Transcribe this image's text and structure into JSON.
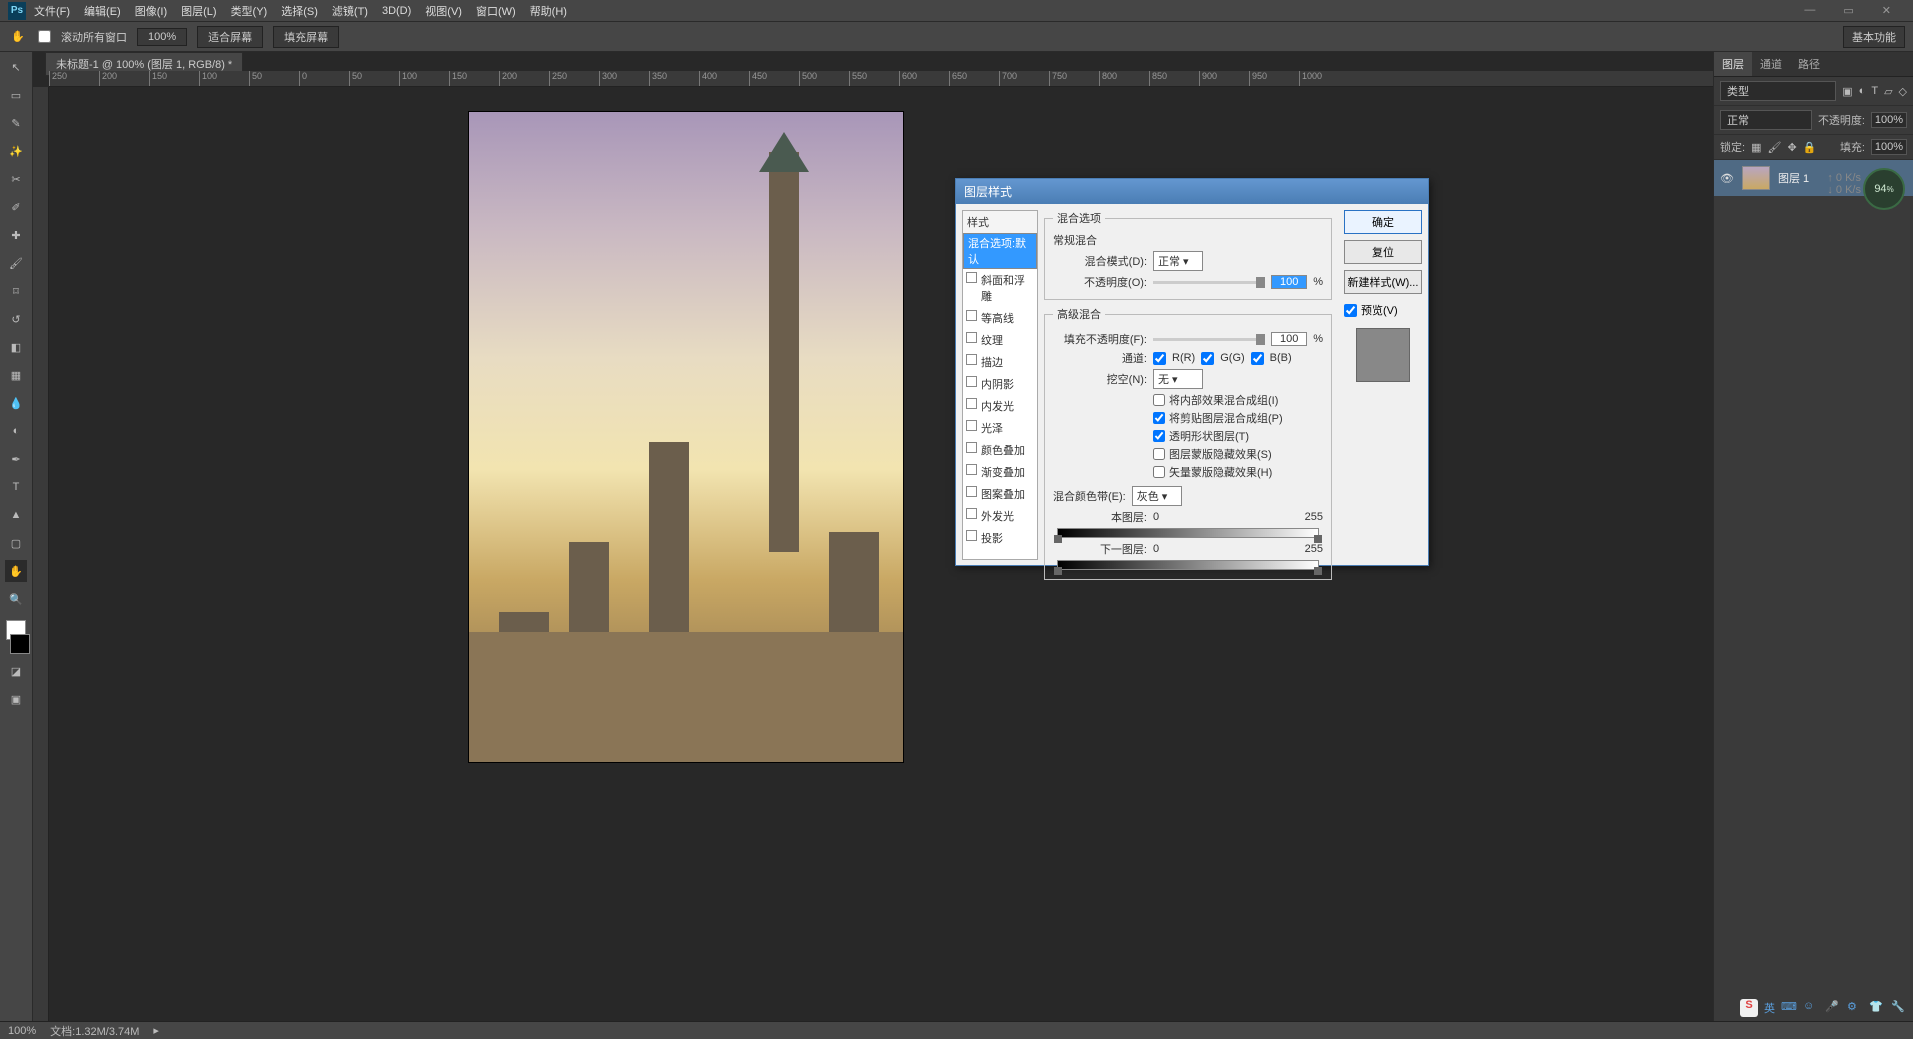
{
  "menu": {
    "items": [
      "文件(F)",
      "编辑(E)",
      "图像(I)",
      "图层(L)",
      "类型(Y)",
      "选择(S)",
      "滤镜(T)",
      "3D(D)",
      "视图(V)",
      "窗口(W)",
      "帮助(H)"
    ]
  },
  "options": {
    "scroll_all": "滚动所有窗口",
    "zoom": "100%",
    "fit": "适合屏幕",
    "fill": "填充屏幕",
    "workspace": "基本功能"
  },
  "document": {
    "tab": "未标题-1 @ 100% (图层 1, RGB/8) *"
  },
  "ruler_marks": [
    "250",
    "200",
    "150",
    "100",
    "50",
    "0",
    "50",
    "100",
    "150",
    "200",
    "250",
    "300",
    "350",
    "400",
    "450",
    "500",
    "550",
    "600",
    "650",
    "700",
    "750",
    "800",
    "850",
    "900",
    "950",
    "1000"
  ],
  "panels": {
    "tabs": [
      "图层",
      "通道",
      "路径"
    ],
    "kind": "类型",
    "mode": "正常",
    "opacity_lbl": "不透明度:",
    "opacity": "100%",
    "lock_lbl": "锁定:",
    "fill_lbl": "填充:",
    "fill": "100%",
    "layer_name": "图层 1"
  },
  "dialog": {
    "title": "图层样式",
    "styles_hdr": "样式",
    "styles": [
      "混合选项:默认",
      "斜面和浮雕",
      "等高线",
      "纹理",
      "描边",
      "内阴影",
      "内发光",
      "光泽",
      "颜色叠加",
      "渐变叠加",
      "图案叠加",
      "外发光",
      "投影"
    ],
    "sel_idx": 0,
    "blend_group": "混合选项",
    "normal_group": "常规混合",
    "blend_mode_lbl": "混合模式(D):",
    "blend_mode": "正常",
    "opacity_lbl": "不透明度(O):",
    "opacity": "100",
    "pct": "%",
    "adv_group": "高级混合",
    "fill_opacity_lbl": "填充不透明度(F):",
    "fill_opacity": "100",
    "channels_lbl": "通道:",
    "ch_r": "R(R)",
    "ch_g": "G(G)",
    "ch_b": "B(B)",
    "knockout_lbl": "挖空(N):",
    "knockout": "无",
    "cb1": "将内部效果混合成组(I)",
    "cb2": "将剪贴图层混合成组(P)",
    "cb3": "透明形状图层(T)",
    "cb4": "图层蒙版隐藏效果(S)",
    "cb5": "矢量蒙版隐藏效果(H)",
    "blendif_lbl": "混合颜色带(E):",
    "blendif": "灰色",
    "this_layer": "本图层:",
    "this_lo": "0",
    "this_hi": "255",
    "under_layer": "下一图层:",
    "under_lo": "0",
    "under_hi": "255",
    "ok": "确定",
    "cancel": "复位",
    "new_style": "新建样式(W)...",
    "preview": "预览(V)"
  },
  "status": {
    "zoom": "100%",
    "doc": "文档:1.32M/3.74M"
  },
  "gauge": {
    "pct": "94",
    "up": "0 K/s",
    "down": "0 K/s"
  },
  "tray": {
    "ime": "英"
  }
}
